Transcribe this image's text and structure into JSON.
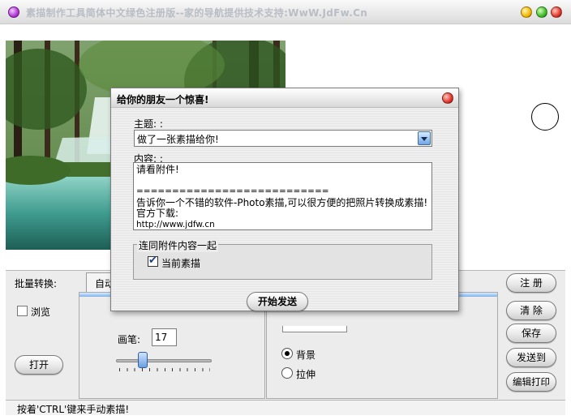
{
  "window": {
    "title": "素描制作工具简体中文绿色注册版--家的导航提供技术支持:WwW.JdFw.Cn"
  },
  "left_panel": {
    "batch_label": "批量转换:",
    "browse_label": "浏览",
    "open_button": "打开"
  },
  "tabs": {
    "auto_label": "自动"
  },
  "pen": {
    "label": "画笔:",
    "value": "17",
    "slider_fraction": 0.25
  },
  "mode": {
    "options": [
      {
        "label": "背景",
        "selected": true
      },
      {
        "label": "拉伸",
        "selected": false
      }
    ]
  },
  "right_buttons": {
    "register": "注 册",
    "clear": "清 除",
    "save": "保存",
    "send_to": "发送到",
    "edit_print": "编辑打印"
  },
  "status": {
    "text": "按着'CTRL'键来手动素描!"
  },
  "dialog": {
    "title": "给你的朋友一个惊喜!",
    "subject_label": "主题: :",
    "subject_value": "做了一张素描给你!",
    "content_label": "内容: :",
    "content_lines": [
      "请看附件!",
      "",
      "===========================",
      "告诉你一个不错的软件-Photo素描,可以很方便的把照片转换成素描!",
      "官方下载:",
      "http://www.jdfw.cn"
    ],
    "attach_group_label": "连同附件内容一起",
    "attach_current_label": "当前素描",
    "attach_current_checked": true,
    "send_button": "开始发送"
  },
  "icons": {
    "app": "app-orb-icon",
    "minimize": "yellow-orb-icon",
    "maximize": "green-orb-icon",
    "close": "red-orb-icon",
    "dialog_close": "red-orb-icon",
    "dropdown": "chevron-down-icon"
  }
}
